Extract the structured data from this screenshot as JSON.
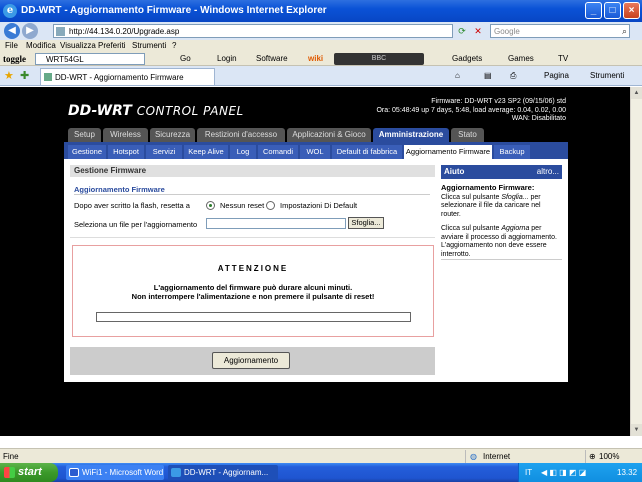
{
  "window": {
    "title": "DD-WRT - Aggiornamento Firmware - Windows Internet Explorer"
  },
  "address": {
    "url": "http://44.134.0.20/Upgrade.asp",
    "search_placeholder": "Google"
  },
  "menu": [
    "File",
    "Modifica",
    "Visualizza",
    "Preferiti",
    "Strumenti",
    "?"
  ],
  "toolbar": {
    "brand": "toggle",
    "search_value": "WRT54GL",
    "go": "Go",
    "login": "Login",
    "software": "Software",
    "wiki": "wiki",
    "player": "BBC",
    "gadgets": "Gadgets",
    "games": "Games",
    "tv": "TV"
  },
  "tab": {
    "label": "DD-WRT - Aggiornamento Firmware"
  },
  "commandbar": {
    "pagina": "Pagina",
    "strumenti": "Strumenti"
  },
  "header": {
    "logo_main": "DD-WRT",
    "logo_sub": "CONTROL PANEL",
    "fw_line1": "Firmware: DD-WRT v23 SP2 (09/15/06) std",
    "fw_line2": "Ora: 05:48:49 up 7 days, 5:48, load average: 0.04, 0.02, 0.00",
    "fw_line3": "WAN: Disabilitato"
  },
  "main_tabs": [
    "Setup",
    "Wireless",
    "Sicurezza",
    "Restizioni d'accesso",
    "Applicazioni & Gioco",
    "Amministrazione",
    "Stato"
  ],
  "sub_tabs": [
    "Gestione",
    "Hotspot",
    "Servizi",
    "Keep Alive",
    "Log",
    "Comandi",
    "WOL",
    "Default di fabbrica",
    "Aggiornamento Firmware",
    "Backup"
  ],
  "section": {
    "title": "Gestione Firmware",
    "legend": "Aggiornamento Firmware",
    "reset_label": "Dopo aver scritto la flash, resetta a",
    "opt_no_reset": "Nessun reset",
    "opt_default": "Impostazioni Di Default",
    "file_label": "Seleziona un file per l'aggiornamento",
    "browse": "Sfoglia..."
  },
  "warning": {
    "title": "ATTENZIONE",
    "line1": "L'aggiornamento del firmware può durare alcuni minuti.",
    "line2": "Non interrompere l'alimentazione e non premere il pulsante di reset!",
    "progress": 0
  },
  "actions": {
    "update": "Aggiornamento"
  },
  "help": {
    "title": "Aiuto",
    "more": "altro...",
    "heading": "Aggiornamento Firmware:",
    "p1_a": "Clicca sul pulsante ",
    "p1_em": "Sfoglia...",
    "p1_b": " per selezionare il file da caricare nel router.",
    "p2_a": "Clicca sul pulsante ",
    "p2_em": "Aggiorna",
    "p2_b": " per avviare il processo di aggiornamento. L'aggiornamento non deve essere interrotto."
  },
  "status": {
    "left": "Fine",
    "zone": "Internet",
    "zoom": "100%"
  },
  "taskbar": {
    "start": "start",
    "task1": "WiFi1 - Microsoft Word",
    "task2": "DD-WRT - Aggiornam...",
    "lang": "IT",
    "clock": "13.32"
  },
  "colors": {
    "accent": "#2b4c9e",
    "tab_inactive": "#555555",
    "warn_border": "#e8a0a0"
  }
}
